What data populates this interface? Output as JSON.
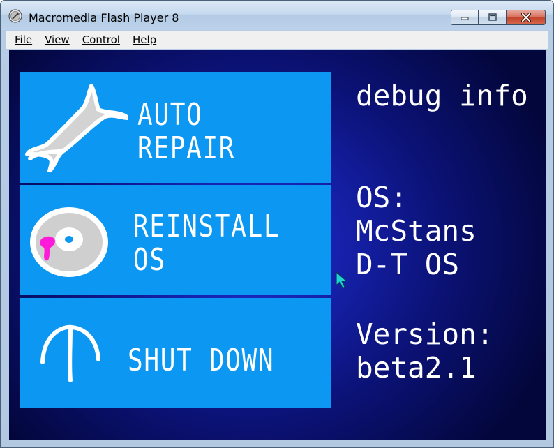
{
  "window": {
    "title": "Macromedia Flash Player 8"
  },
  "menubar": {
    "items": [
      "File",
      "View",
      "Control",
      "Help"
    ]
  },
  "app": {
    "buttons": {
      "auto_repair": "AUTO REPAIR",
      "reinstall": "REINSTALL\nOS",
      "shut_down": "SHUT DOWN"
    },
    "debug": {
      "heading": "debug info",
      "os_label": "OS:",
      "os_value": "McStans\nD-T OS",
      "version_label": "Version:",
      "version_value": "beta2.1"
    }
  },
  "icons": {
    "app_icon": "flash-player-icon",
    "auto_repair": "wrench-icon",
    "reinstall": "disc-icon",
    "shut_down": "umbrella-handle-icon",
    "cursor": "mouse-cursor-icon"
  },
  "colors": {
    "button_fill": "#0b97f2",
    "stage_center": "#1f2fd0",
    "stage_edge": "#03063a",
    "disc_stain": "#ff1ad9",
    "cursor": "#1dd3d3"
  }
}
